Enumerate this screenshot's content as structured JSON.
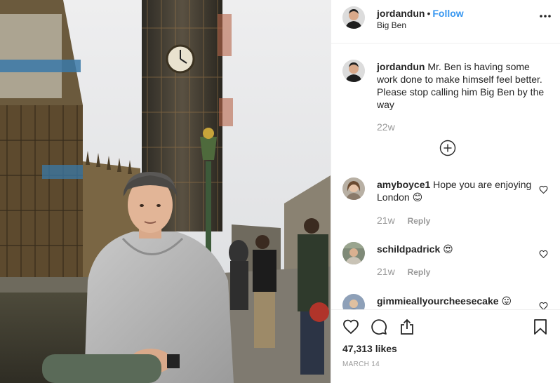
{
  "post": {
    "username": "jordandun",
    "separator": "•",
    "follow_label": "Follow",
    "location": "Big Ben",
    "caption": {
      "username": "jordandun",
      "text": "Mr. Ben is having some work done to make himself feel better. Please stop calling him Big Ben by the way",
      "age": "22w"
    },
    "comments": [
      {
        "username": "amyboyce1",
        "text": "Hope you are enjoying London 😊",
        "age": "21w",
        "reply_label": "Reply"
      },
      {
        "username": "schildpadrick",
        "text": "😍",
        "age": "21w",
        "reply_label": "Reply"
      },
      {
        "username": "gimmieallyourcheesecake",
        "text": "😛",
        "age": "",
        "reply_label": ""
      }
    ],
    "likes": "47,313 likes",
    "date": "MARCH 14"
  },
  "icons": {
    "more": "more-options-icon",
    "load_more": "plus-circle-icon",
    "like": "heart-icon",
    "comment": "comment-icon",
    "share": "share-icon",
    "save": "bookmark-icon"
  },
  "colors": {
    "link": "#3897f0",
    "text": "#262626",
    "muted": "#999999",
    "divider": "#efefef"
  }
}
